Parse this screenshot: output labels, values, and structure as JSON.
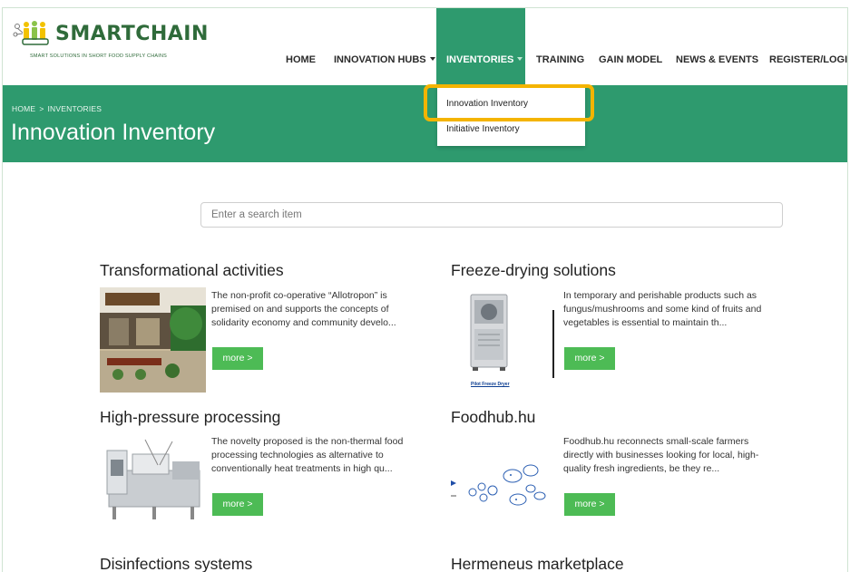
{
  "brand": {
    "name": "SMARTCHAIN",
    "tagline": "SMART SOLUTIONS IN SHORT FOOD SUPPLY CHAINS"
  },
  "nav": {
    "home": "HOME",
    "innovation_hubs": "INNOVATION HUBS",
    "inventories": "INVENTORIES",
    "training": "TRAINING",
    "gain_model": "GAIN MODEL",
    "news_events": "NEWS & EVENTS",
    "register_login": "REGISTER/LOGIN"
  },
  "dropdown": {
    "innovation_inventory": "Innovation Inventory",
    "initiative_inventory": "Initiative Inventory"
  },
  "breadcrumb": {
    "home": "HOME",
    "separator": ">",
    "current": "INVENTORIES"
  },
  "page_title": "Innovation Inventory",
  "search": {
    "placeholder": "Enter a search item"
  },
  "cards": [
    {
      "title": "Transformational activities",
      "text": "The non-profit co-operative “Allotropon” is premised on and supports the concepts of solidarity economy and community develo...",
      "more": "more >"
    },
    {
      "title": "Freeze-drying solutions",
      "text": "In temporary and perishable products such as fungus/mushrooms and some kind of fruits and vegetables is essential to maintain th...",
      "more": "more >",
      "image_caption": "Pilot Freeze Dryer"
    },
    {
      "title": "High-pressure processing",
      "text": "The novelty proposed is the non-thermal food processing technologies as alternative to conventionally heat treatments in high qu...",
      "more": "more >"
    },
    {
      "title": "Foodhub.hu",
      "text": "Foodhub.hu reconnects small-scale farmers directly with businesses looking for local, high-quality fresh ingredients, be they re...",
      "more": "more >"
    },
    {
      "title": "Disinfections systems"
    },
    {
      "title": "Hermeneus marketplace"
    }
  ],
  "colors": {
    "brand_green": "#2e9a6e",
    "button_green": "#4dbb55",
    "highlight": "#f4b400"
  }
}
